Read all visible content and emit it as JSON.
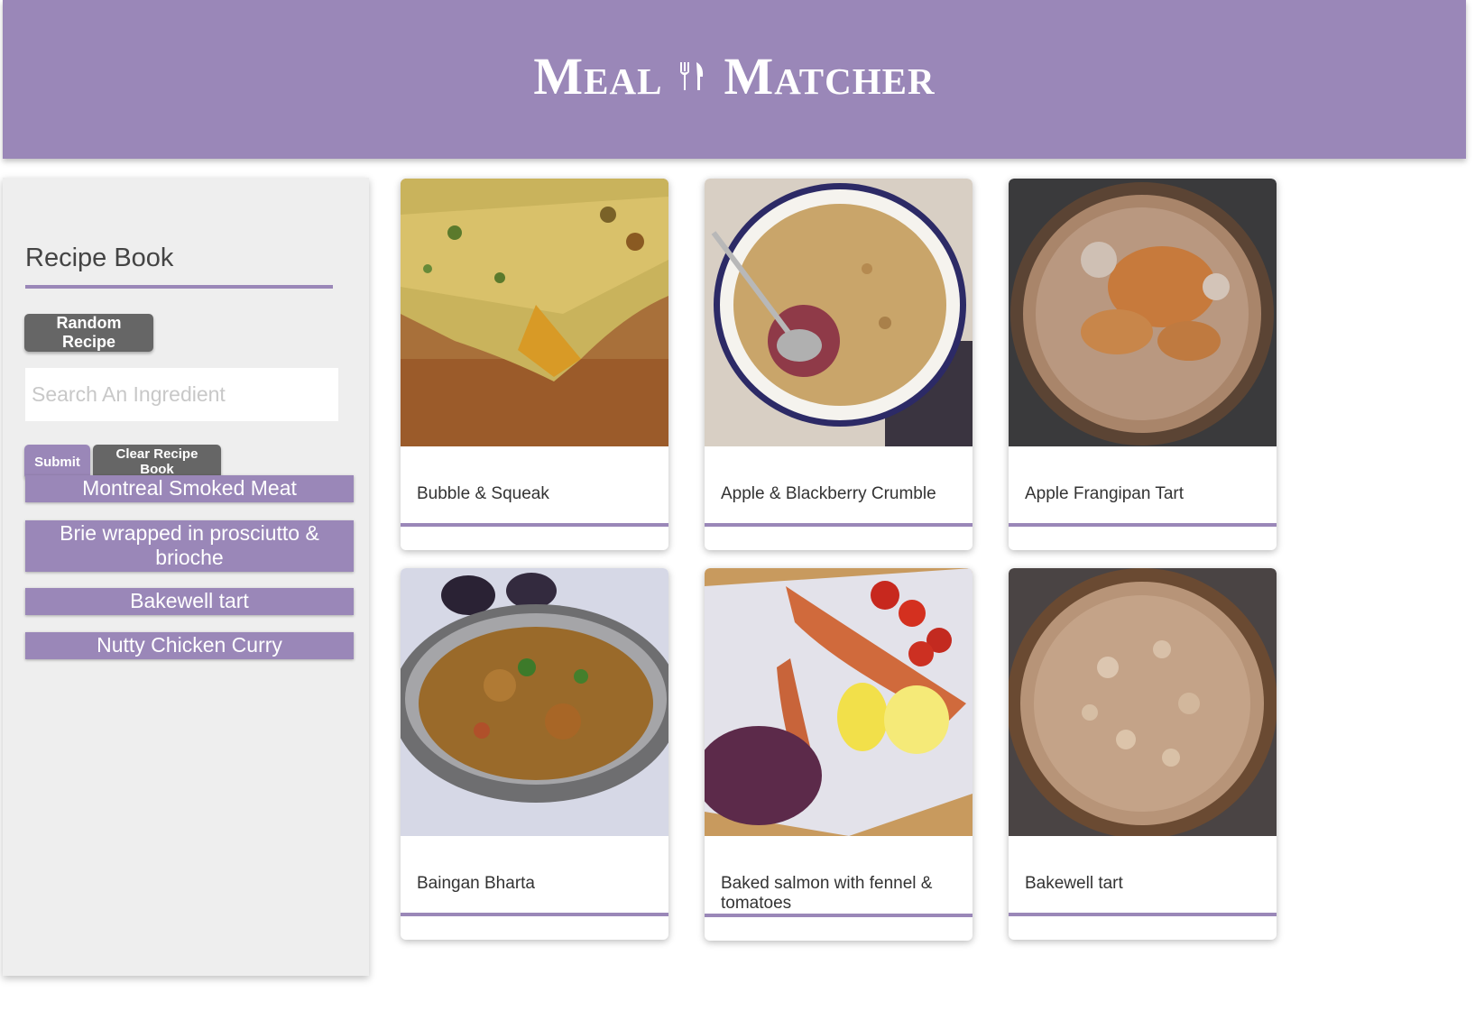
{
  "header": {
    "title_left": "Meal",
    "title_right": "Matcher",
    "logo_icon": "fork-knife-icon",
    "color": "#9a87b8"
  },
  "sidebar": {
    "title": "Recipe Book",
    "random_button": "Random Recipe",
    "search_placeholder": "Search An Ingredient",
    "search_value": "",
    "submit_button": "Submit",
    "clear_button": "Clear Recipe Book",
    "saved_recipes": [
      "Montreal Smoked Meat",
      "Brie wrapped in prosciutto & brioche",
      "Bakewell tart",
      "Nutty Chicken Curry"
    ]
  },
  "recipes": [
    {
      "name": "Bubble & Squeak"
    },
    {
      "name": "Apple & Blackberry Crumble"
    },
    {
      "name": "Apple Frangipan Tart"
    },
    {
      "name": "Baingan Bharta"
    },
    {
      "name": "Baked salmon with fennel & tomatoes"
    },
    {
      "name": "Bakewell tart"
    }
  ]
}
